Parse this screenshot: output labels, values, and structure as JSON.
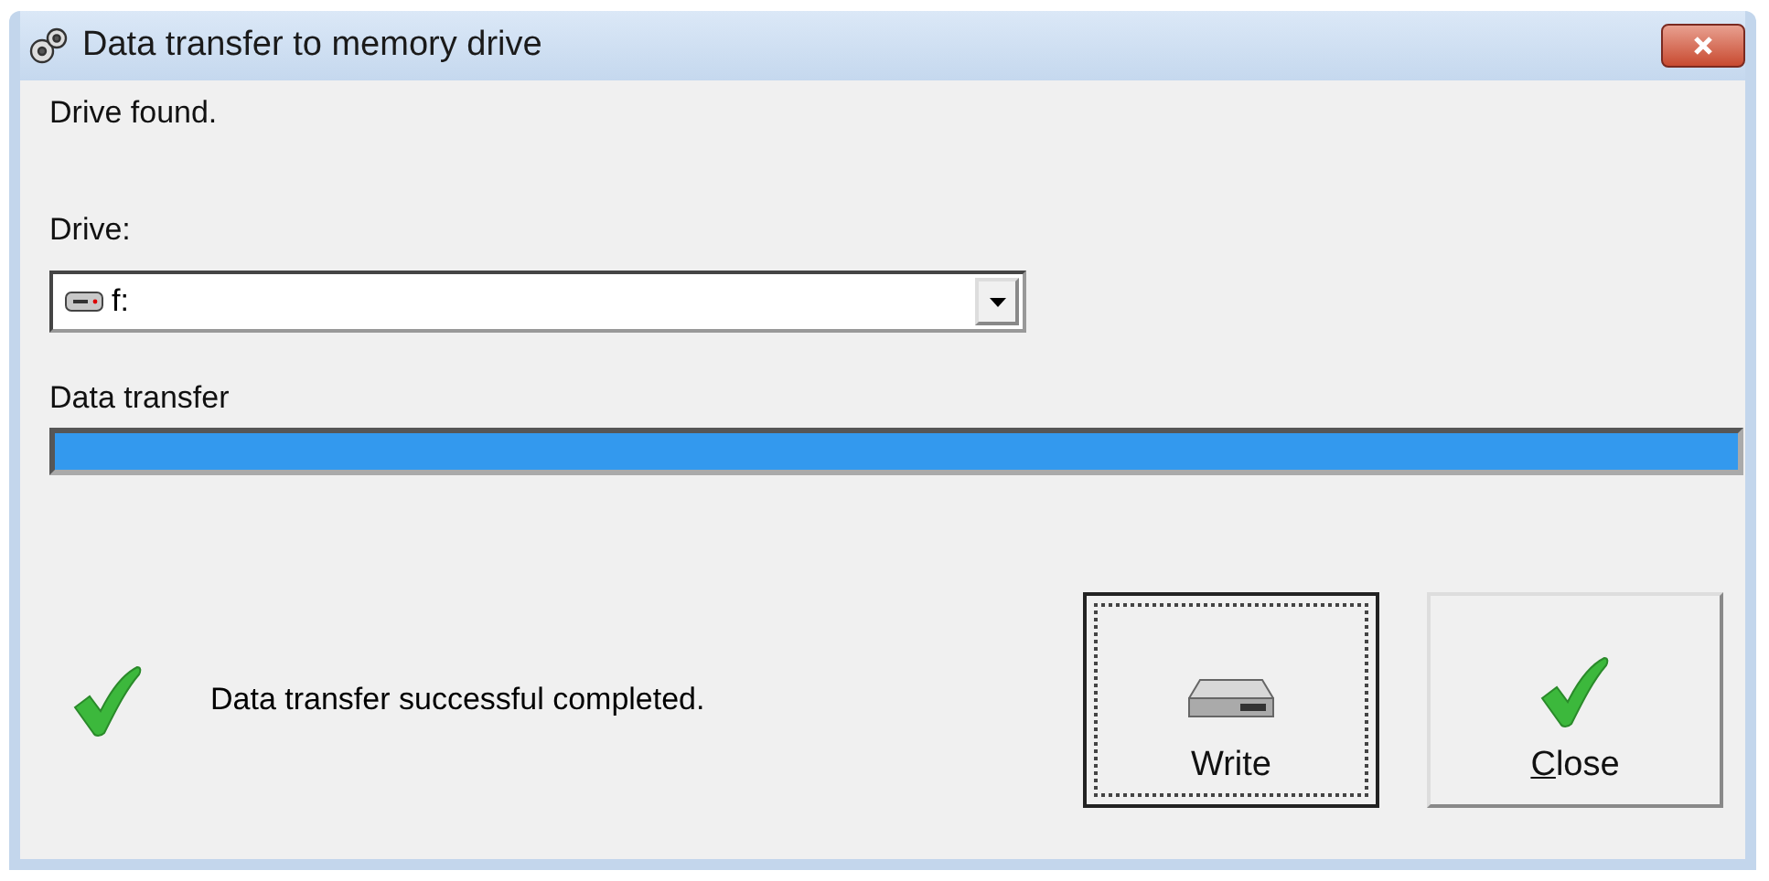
{
  "window": {
    "title": "Data transfer to memory drive"
  },
  "status_text": "Drive found.",
  "drive": {
    "label": "Drive:",
    "value": "f:"
  },
  "transfer": {
    "label": "Data transfer",
    "level": 1
  },
  "result": {
    "message": "Data transfer successful completed."
  },
  "buttons": [
    {
      "kind": "write",
      "label": "Write",
      "focused": true
    },
    {
      "kind": "close",
      "label": "Close",
      "focused": false
    }
  ]
}
